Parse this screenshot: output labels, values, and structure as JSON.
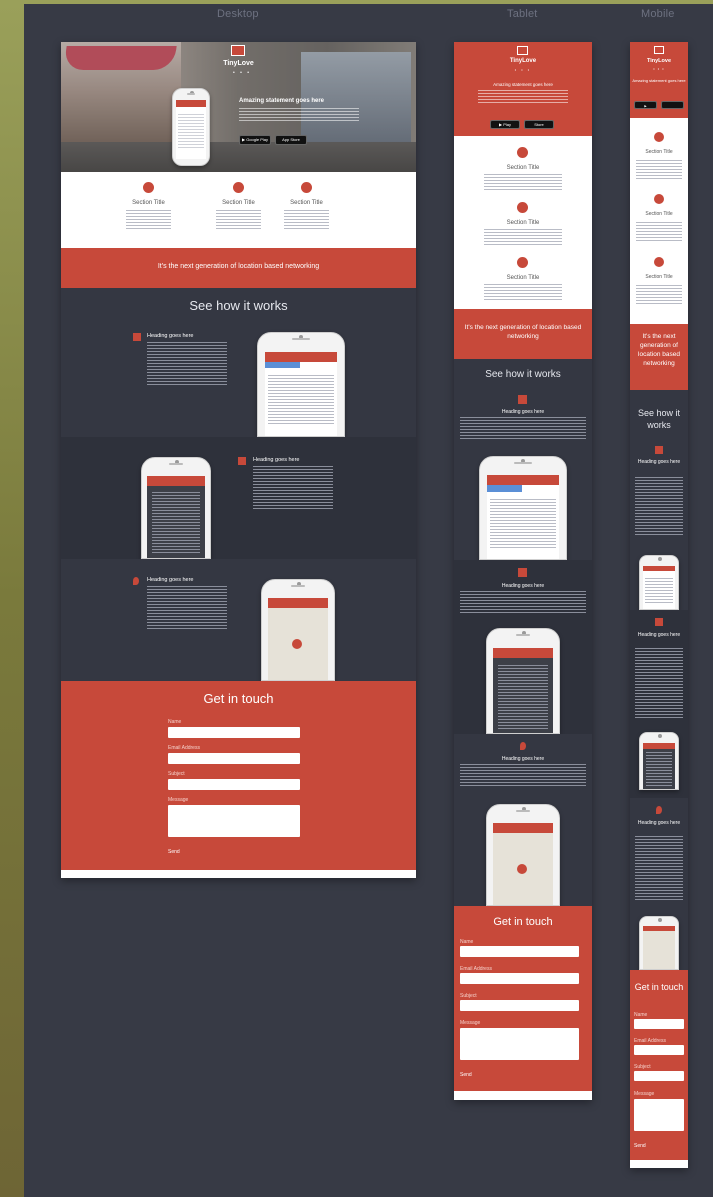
{
  "columns": {
    "desktop": "Desktop",
    "tablet": "Tablet",
    "mobile": "Mobile"
  },
  "brand": "TinyLove",
  "hero_statement": "Amazing statement goes here",
  "sections": [
    {
      "title": "Section Title"
    },
    {
      "title": "Section Title"
    },
    {
      "title": "Section Title"
    }
  ],
  "banner": "It's the next generation of location based networking",
  "how_it_works": "See how it works",
  "feature_heading": "Heading goes here",
  "contact": {
    "title": "Get in touch",
    "name_label": "Name",
    "email_label": "Email Address",
    "subject_label": "Subject",
    "message_label": "Message",
    "send_label": "Send"
  },
  "colors": {
    "accent": "#c7493a",
    "panel": "#373a45",
    "dark": "#2e313b"
  },
  "icons": [
    "check-icon",
    "map-pin-icon",
    "list-icon",
    "user-icon",
    "apple-icon",
    "android-icon"
  ]
}
